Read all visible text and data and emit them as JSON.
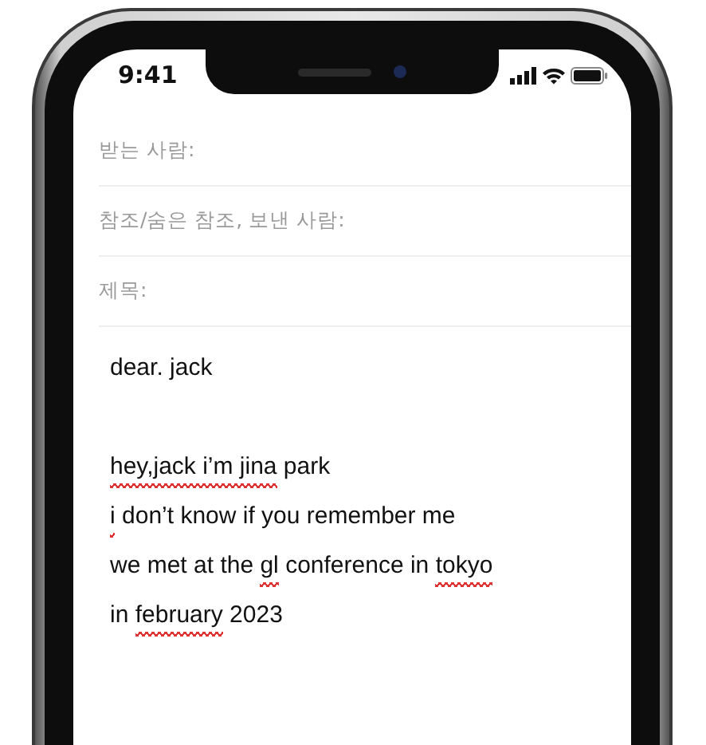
{
  "status_bar": {
    "time": "9:41"
  },
  "fields": [
    {
      "label": "받는 사람:"
    },
    {
      "label": "참조/숨은 참조, 보낸 사람:"
    },
    {
      "label": "제목:"
    }
  ],
  "body": {
    "lines": [
      {
        "kind": "text",
        "segments": [
          {
            "text": "dear. jack",
            "misspelled": false
          }
        ]
      },
      {
        "kind": "blank"
      },
      {
        "kind": "text",
        "segments": [
          {
            "text": "hey,jack i’m jina",
            "misspelled": true
          },
          {
            "text": " park",
            "misspelled": false
          }
        ]
      },
      {
        "kind": "text",
        "segments": [
          {
            "text": "i",
            "misspelled": true
          },
          {
            "text": " don’t know if you remember me",
            "misspelled": false
          }
        ]
      },
      {
        "kind": "text",
        "segments": [
          {
            "text": "we met at the ",
            "misspelled": false
          },
          {
            "text": "gl",
            "misspelled": true
          },
          {
            "text": " conference in ",
            "misspelled": false
          },
          {
            "text": "tokyo",
            "misspelled": true
          }
        ]
      },
      {
        "kind": "text",
        "segments": [
          {
            "text": "in ",
            "misspelled": false
          },
          {
            "text": "february",
            "misspelled": true
          },
          {
            "text": " 2023",
            "misspelled": false
          }
        ]
      }
    ]
  }
}
